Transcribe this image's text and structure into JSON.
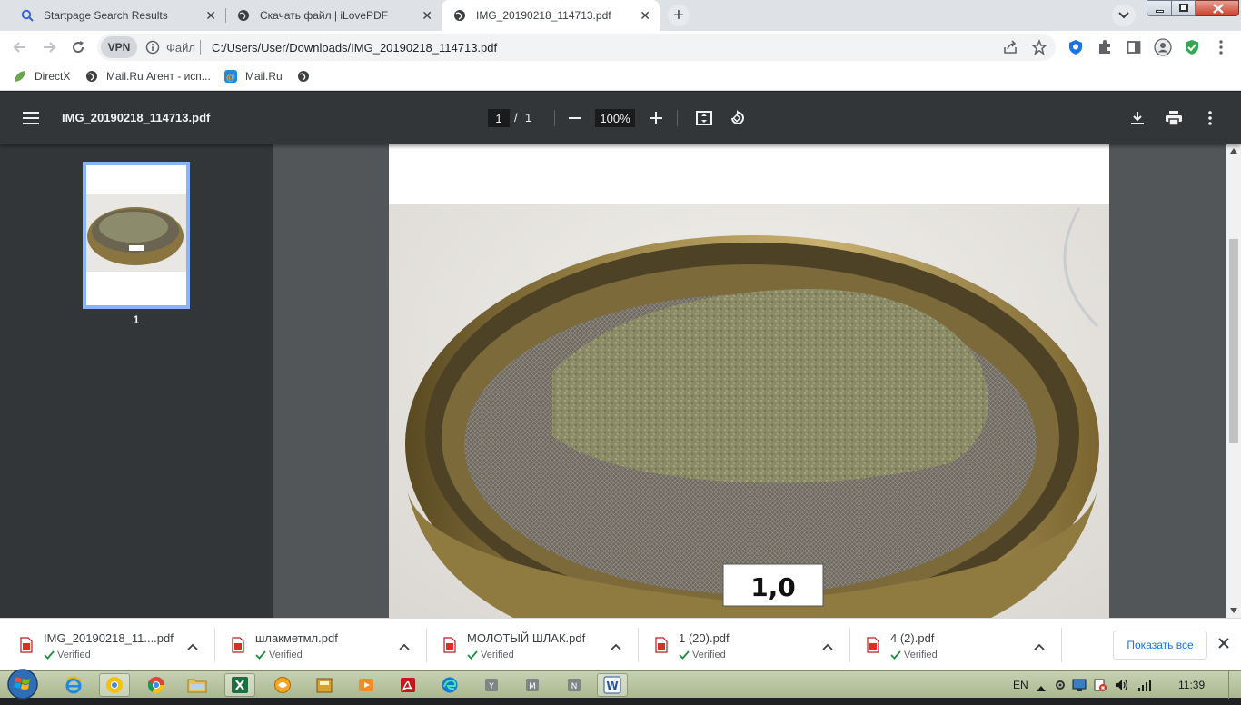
{
  "browser": {
    "tabs": [
      {
        "title": "Startpage Search Results",
        "icon": "search-icon",
        "active": false
      },
      {
        "title": "Скачать файл | iLovePDF",
        "icon": "globe-icon",
        "active": false
      },
      {
        "title": "IMG_20190218_114713.pdf",
        "icon": "globe-icon",
        "active": true
      }
    ],
    "omnibox": {
      "vpn_label": "VPN",
      "scheme_label": "Файл",
      "url": "C:/Users/User/Downloads/IMG_20190218_114713.pdf"
    },
    "bookmarks": [
      {
        "label": "DirectX",
        "icon": "leaf-icon"
      },
      {
        "label": "Mail.Ru Агент - исп...",
        "icon": "globe-icon"
      },
      {
        "label": "Mail.Ru",
        "icon": "mailru-icon"
      },
      {
        "label": "",
        "icon": "globe-icon"
      }
    ]
  },
  "pdf_viewer": {
    "filename": "IMG_20190218_114713.pdf",
    "current_page": "1",
    "page_separator": "/",
    "total_pages": "1",
    "zoom": "100%",
    "thumbnail_label": "1",
    "photo_label_text": "1,0"
  },
  "downloads": {
    "items": [
      {
        "name": "IMG_20190218_11....pdf",
        "status": "Verified"
      },
      {
        "name": "шлакметмл.pdf",
        "status": "Verified"
      },
      {
        "name": "МОЛОТЫЙ ШЛАК.pdf",
        "status": "Verified"
      },
      {
        "name": "1 (20).pdf",
        "status": "Verified"
      },
      {
        "name": "4 (2).pdf",
        "status": "Verified"
      }
    ],
    "show_all_label": "Показать все"
  },
  "taskbar": {
    "language": "EN",
    "clock": "11:39"
  },
  "colors": {
    "pdf_toolbar": "#323639",
    "viewer_bg": "#525659",
    "thumb_border": "#8ab4f8",
    "verified_green": "#1e8e3e"
  }
}
